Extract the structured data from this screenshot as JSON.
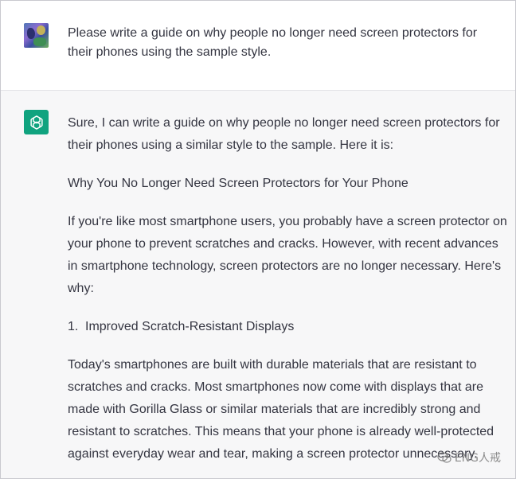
{
  "user_message": {
    "text": "Please write a guide on why people no longer need screen protectors for their phones using the sample style."
  },
  "assistant_message": {
    "intro": "Sure, I can write a guide on why people no longer need screen protectors for their phones using a similar style to the sample. Here it is:",
    "title": "Why You No Longer Need Screen Protectors for Your Phone",
    "paragraph1": "If you're like most smartphone users, you probably have a screen protector on your phone to prevent scratches and cracks. However, with recent advances in smartphone technology, screen protectors are no longer necessary. Here's why:",
    "list": [
      {
        "number": "1.",
        "text": "Improved Scratch-Resistant Displays"
      }
    ],
    "paragraph2": "Today's smartphones are built with durable materials that are resistant to scratches and cracks. Most smartphones now come with displays that are made with Gorilla Glass or similar materials that are incredibly strong and resistant to scratches. This means that your phone is already well-protected against everyday wear and tear, making a screen protector unnecessary."
  },
  "watermark": {
    "text": "ENG人戒"
  },
  "colors": {
    "bot_avatar": "#10a37f",
    "bot_background": "#f7f7f8",
    "text": "#343541"
  }
}
